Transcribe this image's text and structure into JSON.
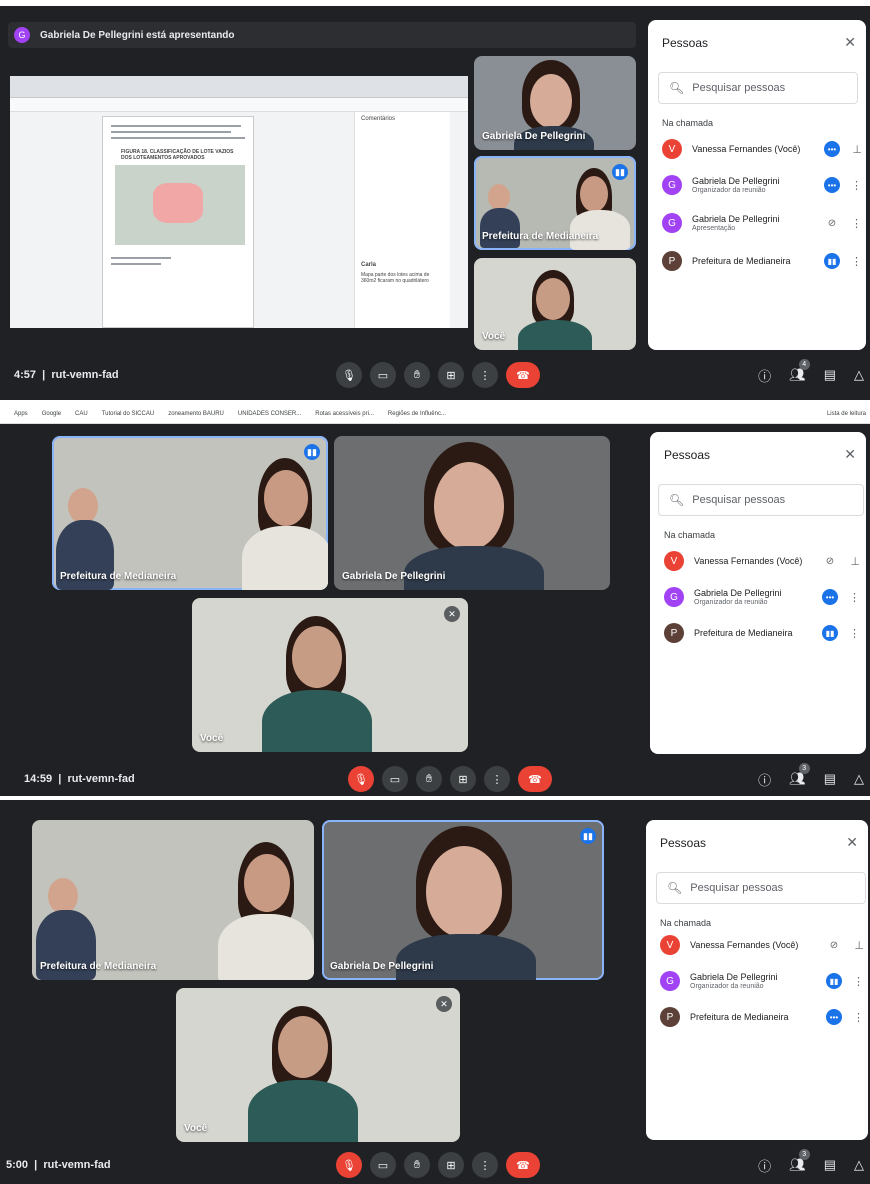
{
  "colors": {
    "bg": "#202124",
    "accent": "#1a73e8",
    "red": "#ea4335",
    "avatar_v": "#ea4335",
    "avatar_g": "#a142f4",
    "avatar_p": "#5d4037"
  },
  "panel1": {
    "presenting": "Gabriela De Pellegrini está apresentando",
    "presenter_initial": "G",
    "tiles": [
      {
        "name": "Gabriela De Pellegrini"
      },
      {
        "name": "Prefeitura de Medianeira"
      },
      {
        "name": "Você"
      }
    ],
    "clock": "4:57",
    "meeting_code": "rut-vemn-fad",
    "people_count": "4",
    "side": {
      "title": "Pessoas",
      "search_placeholder": "Pesquisar pessoas",
      "section": "Na chamada",
      "people": [
        {
          "initial": "V",
          "name": "Vanessa Fernandes (Você)",
          "role": ""
        },
        {
          "initial": "G",
          "name": "Gabriela De Pellegrini",
          "role": "Organizador da reunião"
        },
        {
          "initial": "G",
          "name": "Gabriela De Pellegrini",
          "role": "Apresentação"
        },
        {
          "initial": "P",
          "name": "Prefeitura de Medianeira",
          "role": ""
        }
      ]
    },
    "doc": {
      "title": "FIGURA 18. CLASSIFICAÇÃO DE LOTE VAZIOS DOS LOTEAMENTOS APROVADOS",
      "comments_title": "Comentários",
      "comment_author": "Carla",
      "comment_text": "Mapa parte dos lotes acima de 360m2 ficaram no quadrilátero"
    }
  },
  "panel2": {
    "bookmarks": [
      "Apps",
      "Google",
      "CAU",
      "Tutorial do SICCAU",
      "zoneamento BAURU",
      "UNIDADES CONSER...",
      "Rotas acessíveis pri...",
      "Regiões de Influênc...",
      "Lista de leitura"
    ],
    "tiles": [
      {
        "name": "Prefeitura de Medianeira"
      },
      {
        "name": "Gabriela De Pellegrini"
      },
      {
        "name": "Você"
      }
    ],
    "clock": "14:59",
    "meeting_code": "rut-vemn-fad",
    "people_count": "3",
    "side": {
      "title": "Pessoas",
      "search_placeholder": "Pesquisar pessoas",
      "section": "Na chamada",
      "people": [
        {
          "initial": "V",
          "name": "Vanessa Fernandes (Você)",
          "role": ""
        },
        {
          "initial": "G",
          "name": "Gabriela De Pellegrini",
          "role": "Organizador da reunião"
        },
        {
          "initial": "P",
          "name": "Prefeitura de Medianeira",
          "role": ""
        }
      ]
    }
  },
  "panel3": {
    "tiles": [
      {
        "name": "Prefeitura de Medianeira"
      },
      {
        "name": "Gabriela De Pellegrini"
      },
      {
        "name": "Você"
      }
    ],
    "clock": "5:00",
    "meeting_code": "rut-vemn-fad",
    "people_count": "3",
    "side": {
      "title": "Pessoas",
      "search_placeholder": "Pesquisar pessoas",
      "section": "Na chamada",
      "people": [
        {
          "initial": "V",
          "name": "Vanessa Fernandes (Você)",
          "role": ""
        },
        {
          "initial": "G",
          "name": "Gabriela De Pellegrini",
          "role": "Organizador da reunião"
        },
        {
          "initial": "P",
          "name": "Prefeitura de Medianeira",
          "role": ""
        }
      ]
    }
  }
}
